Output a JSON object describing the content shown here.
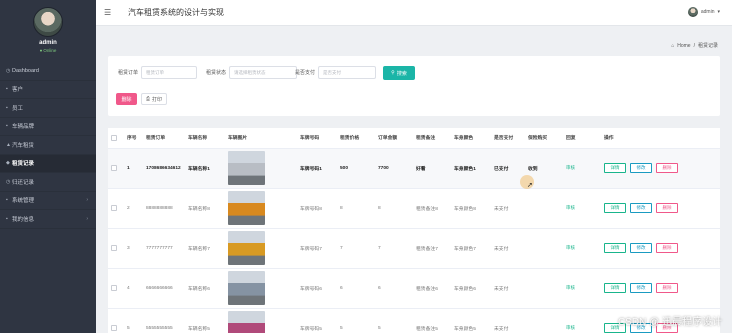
{
  "profile": {
    "name": "admin",
    "status": "Online"
  },
  "sidebar": {
    "items": [
      {
        "icon": "dashboard-icon",
        "glyph": "◷",
        "label": "Dashboard",
        "active": false
      },
      {
        "icon": "user-icon",
        "glyph": "▪",
        "label": "客户",
        "active": false
      },
      {
        "icon": "staff-icon",
        "glyph": "▪",
        "label": "员工",
        "active": false
      },
      {
        "icon": "car-icon",
        "glyph": "▪",
        "label": "车辆品牌",
        "active": false
      },
      {
        "icon": "car-rent-icon",
        "glyph": "▲",
        "label": "汽车租赁",
        "active": false
      },
      {
        "icon": "record-icon",
        "glyph": "◆",
        "label": "租赁记录",
        "active": true
      },
      {
        "icon": "return-icon",
        "glyph": "◷",
        "label": "归还记录",
        "active": false
      },
      {
        "icon": "gear-icon",
        "glyph": "▪",
        "label": "系统管理",
        "active": false,
        "expandable": true
      },
      {
        "icon": "info-icon",
        "glyph": "▪",
        "label": "我的信息",
        "active": false,
        "expandable": true
      }
    ]
  },
  "topbar": {
    "title": "汽车租赁系统的设计与实现",
    "username": "admin"
  },
  "breadcrumb": {
    "home": "Home",
    "separator": "/",
    "current": "租赁记录"
  },
  "search": {
    "fields": [
      {
        "label": "租赁订单",
        "placeholder": "租赁订单"
      },
      {
        "label": "租赁状态",
        "placeholder": "请选择租赁状态"
      },
      {
        "label": "是否支付",
        "placeholder": "是否支付"
      }
    ],
    "search_label": "搜索",
    "delete_label": "删除",
    "print_label": "打印"
  },
  "table": {
    "columns": [
      "",
      "序号",
      "租赁订单",
      "车辆名称",
      "车辆图片",
      "",
      "车牌号码",
      "租赁价格",
      "订单金额",
      "租赁备注",
      "车身颜色",
      "是否支付",
      "保险购买",
      "回复",
      "操作"
    ],
    "ops": {
      "detail": "详情",
      "edit": "修改",
      "delete": "删除"
    },
    "rows": [
      {
        "idx": "1",
        "order": "1708686634612",
        "name": "车辆名称1",
        "img": "#b8bdc4",
        "plate": "车牌号码1",
        "price": "500",
        "amount": "7700",
        "remark": "好看",
        "color": "车身颜色1",
        "paid": "已支付",
        "insurance": "收到",
        "status": "审核"
      },
      {
        "idx": "2",
        "order": "8888888888",
        "name": "车辆名称8",
        "img": "#d8891f",
        "plate": "车牌号码8",
        "price": "8",
        "amount": "8",
        "remark": "租赁备注8",
        "color": "车身颜色8",
        "paid": "未支付",
        "insurance": "",
        "status": "审核"
      },
      {
        "idx": "3",
        "order": "7777777777",
        "name": "车辆名称7",
        "img": "#d89a23",
        "plate": "车牌号码7",
        "price": "7",
        "amount": "7",
        "remark": "租赁备注7",
        "color": "车身颜色7",
        "paid": "未支付",
        "insurance": "",
        "status": "审核"
      },
      {
        "idx": "4",
        "order": "6666666666",
        "name": "车辆名称6",
        "img": "#8593a3",
        "plate": "车牌号码6",
        "price": "6",
        "amount": "6",
        "remark": "租赁备注6",
        "color": "车身颜色6",
        "paid": "未支付",
        "insurance": "",
        "status": "审核"
      },
      {
        "idx": "5",
        "order": "5555555555",
        "name": "车辆名称5",
        "img": "#b04a7a",
        "plate": "车牌号码5",
        "price": "5",
        "amount": "5",
        "remark": "租赁备注5",
        "color": "车身颜色5",
        "paid": "未支付",
        "insurance": "",
        "status": "审核"
      }
    ]
  },
  "watermark": "CSDN @ 迅晨程序设计"
}
